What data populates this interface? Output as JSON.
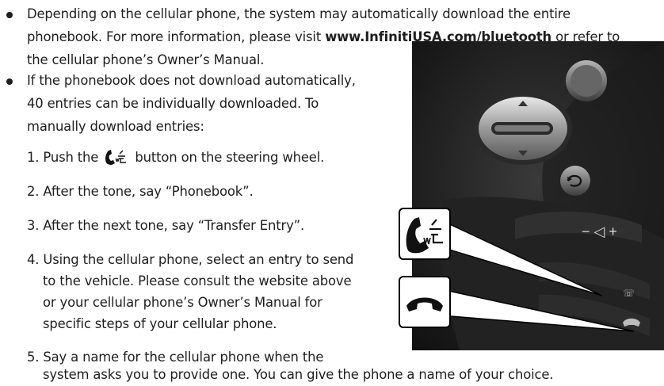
{
  "bullet1": {
    "line1": "Depending on the cellular phone, the system may automatically download the entire",
    "line2_pre": "phonebook. For more information, please visit ",
    "link": "www.InfinitiUSA.com/bluetooth",
    "line2_post": " or refer to",
    "line3": "the cellular phone’s Owner’s Manual."
  },
  "bullet2": {
    "line1": "If the phonebook does not download automatically,",
    "line2": "40 entries can be individually downloaded. To",
    "line3": "manually download entries:"
  },
  "steps": {
    "s1_pre": "1. Push the ",
    "s1_post": " button on the steering wheel.",
    "s2": "2. After the tone, say “Phonebook”.",
    "s3": "3. After the next tone, say “Transfer Entry”.",
    "s4_l1": "4. Using the cellular phone, select an entry to send",
    "s4_l2": "to the vehicle. Please consult the website above",
    "s4_l3": "or your cellular phone’s Owner’s Manual for",
    "s4_l4": "specific steps of your cellular phone.",
    "s5_l1": "5. Say a name for the cellular phone when the",
    "s5_l2": "system asks you to provide one. You can give the phone a name of your choice."
  },
  "icons": {
    "talk": "phone-talk-icon",
    "hangup": "phone-hangup-icon",
    "back": "back-arrow-icon",
    "volume": "volume-icon"
  },
  "colors": {
    "text": "#1e1e1e",
    "photo_bg": "#161616",
    "callout_border": "#000000"
  }
}
